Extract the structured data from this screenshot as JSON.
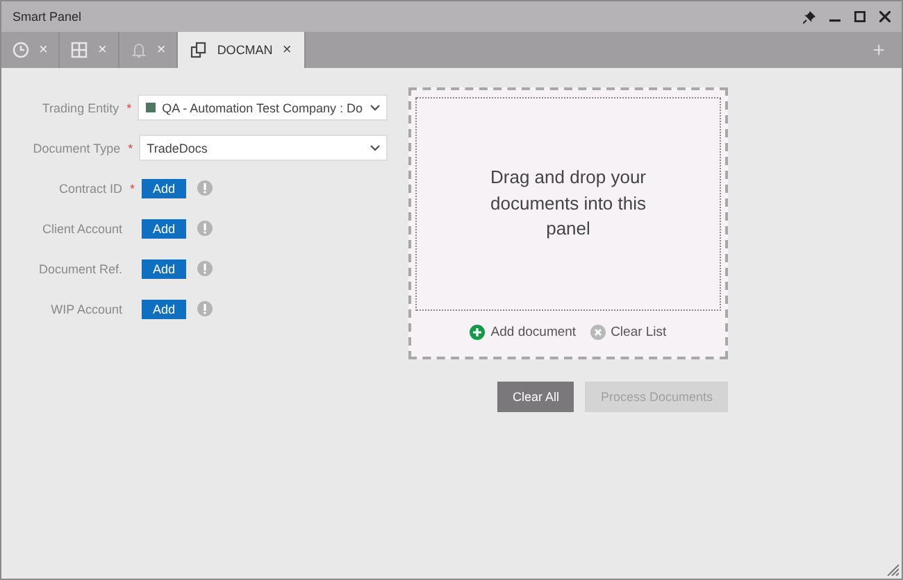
{
  "window": {
    "title": "Smart Panel"
  },
  "tabs": [
    {
      "close": "×",
      "selected": false
    },
    {
      "close": "×",
      "selected": false
    },
    {
      "close": "×",
      "selected": false
    },
    {
      "label": "DOCMAN",
      "close": "×",
      "selected": true
    }
  ],
  "add_tab": "+",
  "form": [
    {
      "kind": "select",
      "label": "Trading Entity",
      "required": true,
      "value": "QA - Automation Test Company : Do",
      "swatch": true
    },
    {
      "kind": "select",
      "label": "Document Type",
      "required": true,
      "value": "TradeDocs",
      "swatch": false
    },
    {
      "kind": "add",
      "label": "Contract ID",
      "required": true,
      "button": "Add"
    },
    {
      "kind": "add",
      "label": "Client Account",
      "required": false,
      "button": "Add"
    },
    {
      "kind": "add",
      "label": "Document Ref.",
      "required": false,
      "button": "Add"
    },
    {
      "kind": "add",
      "label": "WIP Account",
      "required": false,
      "button": "Add"
    }
  ],
  "required_mark": "*",
  "drop_panel": {
    "message": "Drag and drop your documents into this panel",
    "add_document": "Add document",
    "clear_list": "Clear List"
  },
  "buttons": [
    {
      "label": "Clear All",
      "disabled": false
    },
    {
      "label": "Process Documents",
      "disabled": true
    }
  ]
}
